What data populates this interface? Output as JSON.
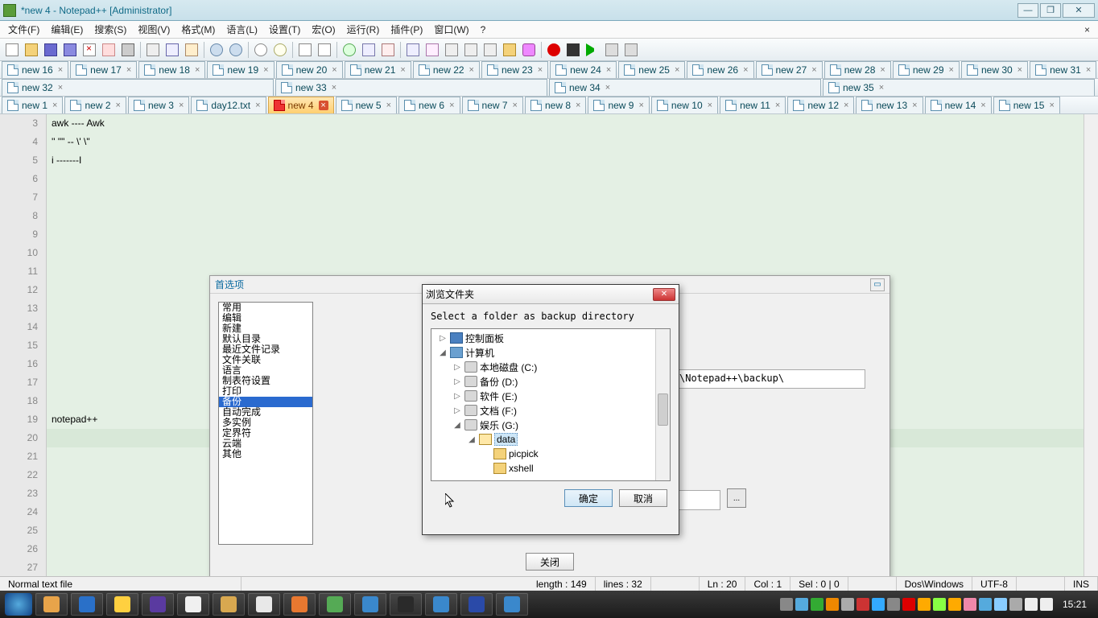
{
  "title": "*new 4 - Notepad++ [Administrator]",
  "menu": [
    "文件(F)",
    "编辑(E)",
    "搜索(S)",
    "视图(V)",
    "格式(M)",
    "语言(L)",
    "设置(T)",
    "宏(O)",
    "运行(R)",
    "插件(P)",
    "窗口(W)",
    "?"
  ],
  "tabs_row1": [
    "new 16",
    "new 17",
    "new 18",
    "new 19",
    "new 20",
    "new 21",
    "new 22",
    "new 23",
    "new 24",
    "new 25",
    "new 26",
    "new 27",
    "new 28",
    "new 29",
    "new 30",
    "new 31"
  ],
  "tabs_row2": [
    "new 32",
    "new 33",
    "new 34",
    "new 35"
  ],
  "tabs_row3": [
    "new 1",
    "new 2",
    "new 3",
    "day12.txt",
    "new 4",
    "new 5",
    "new 6",
    "new 7",
    "new 8",
    "new 9",
    "new 10",
    "new 11",
    "new 12",
    "new 13",
    "new 14",
    "new 15"
  ],
  "active_tab": "new 4",
  "gutter_start": 3,
  "gutter_end": 27,
  "code_lines": {
    "3": "awk ---- Awk",
    "4": "'' \"\" -- \\' \\\"",
    "5": "i -------I",
    "19": "notepad++"
  },
  "prefs": {
    "title": "首选项",
    "items": [
      "常用",
      "编辑",
      "新建",
      "默认目录",
      "最近文件记录",
      "文件关联",
      "语言",
      "制表符设置",
      "打印",
      "备份",
      "自动完成",
      "多实例",
      "定界符",
      "云端",
      "其他"
    ],
    "selected": "备份",
    "backup_path_shown": "\\Notepad++\\backup\\",
    "browse_btn": "...",
    "close_btn": "关闭"
  },
  "browse": {
    "title": "浏览文件夹",
    "instruction": "Select a folder as backup directory",
    "tree": [
      {
        "indent": 0,
        "expand": "▷",
        "icon": "ctrl",
        "label": "控制面板"
      },
      {
        "indent": 0,
        "expand": "◢",
        "icon": "comp",
        "label": "计算机"
      },
      {
        "indent": 1,
        "expand": "▷",
        "icon": "disk",
        "label": "本地磁盘 (C:)"
      },
      {
        "indent": 1,
        "expand": "▷",
        "icon": "disk",
        "label": "备份 (D:)"
      },
      {
        "indent": 1,
        "expand": "▷",
        "icon": "disk",
        "label": "软件 (E:)"
      },
      {
        "indent": 1,
        "expand": "▷",
        "icon": "disk",
        "label": "文档 (F:)"
      },
      {
        "indent": 1,
        "expand": "◢",
        "icon": "disk",
        "label": "娱乐 (G:)"
      },
      {
        "indent": 2,
        "expand": "◢",
        "icon": "folder-open",
        "label": "data",
        "selected": true
      },
      {
        "indent": 3,
        "expand": "",
        "icon": "folder",
        "label": "picpick"
      },
      {
        "indent": 3,
        "expand": "",
        "icon": "folder",
        "label": "xshell"
      }
    ],
    "ok": "确定",
    "cancel": "取消"
  },
  "status": {
    "type": "Normal text file",
    "length": "length : 149",
    "lines": "lines : 32",
    "ln": "Ln : 20",
    "col": "Col : 1",
    "sel": "Sel : 0 | 0",
    "eol": "Dos\\Windows",
    "enc": "UTF-8",
    "ins": "INS"
  },
  "taskbar": {
    "apps": [
      "#e8a44a",
      "#2a70c8",
      "#ffd040",
      "#5a3aa0",
      "#f0f0f0",
      "#d8a850",
      "#e8e8e8",
      "#e87830",
      "#55aa55",
      "#3a88cc",
      "#2a2a2a",
      "#3a88cc",
      "#2a4aa8",
      "#3a88cc"
    ],
    "tray": [
      "#888",
      "#5ad",
      "#3a3",
      "#e80",
      "#aaa",
      "#c33",
      "#3af",
      "#888",
      "#d00",
      "#fa0",
      "#8f4",
      "#fa0",
      "#e8a",
      "#5ad",
      "#8cf",
      "#aaa",
      "#eee",
      "#eee"
    ],
    "clock": "15:21"
  }
}
